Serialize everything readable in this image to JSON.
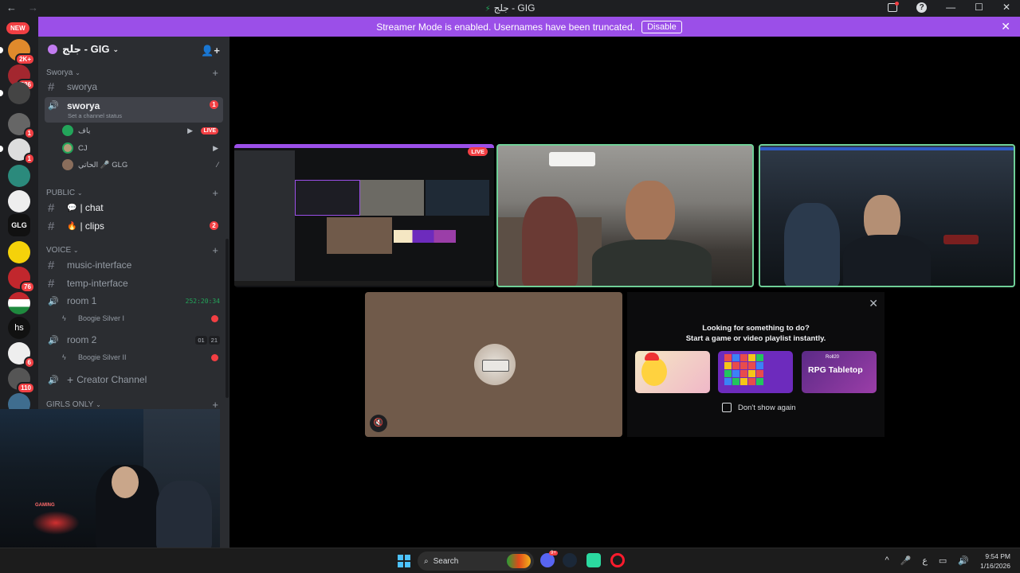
{
  "titlebar": {
    "back_icon": "←",
    "forward_icon": "→",
    "title_prefix": "⚡",
    "title": "جلج - GIG",
    "help_icon": "?",
    "minimize_icon": "—",
    "maximize_icon": "☐",
    "close_icon": "✕"
  },
  "guilds": {
    "new_label": "NEW",
    "badges": [
      "2K+",
      "536",
      "1",
      "1",
      "76",
      "6",
      "110"
    ],
    "hs_label": "hs",
    "glg_label": "GLG"
  },
  "banner": {
    "text": "Streamer Mode is enabled. Usernames have been truncated.",
    "disable_label": "Disable",
    "close_icon": "✕"
  },
  "server": {
    "name": "جلج - GIG",
    "caret": "⌄",
    "invite_icon": "👤+"
  },
  "categories": {
    "sworya": "Sworya",
    "public": "PUBLIC",
    "voice": "VOICE",
    "girls_only": "GIRLS ONLY"
  },
  "channels": {
    "sworya_text": "sworya",
    "sworya_voice": "sworya",
    "sworya_voice_badge": "1",
    "sworya_status": "Set a channel status",
    "chat": "| chat",
    "chat_emoji": "💬",
    "clips": "| clips",
    "clips_emoji": "🔥",
    "clips_badge": "2",
    "music_interface": "music-interface",
    "temp_interface": "temp-interface",
    "room1": "room 1",
    "room1_timer": "252:20:34",
    "room2": "room 2",
    "room2_pill_a": "01",
    "room2_pill_b": "21",
    "creator_channel": "Creator Channel",
    "creator_plus": "+"
  },
  "voice_users": {
    "user1": "ياف",
    "user1_live": "LIVE",
    "user2": "CJ",
    "user3": "الحاتي 🎤 GLG"
  },
  "bots": {
    "boogie1": "Boogie Silver I",
    "boogie2": "Boogie Silver II"
  },
  "stage": {
    "live_label": "LIVE",
    "mute_icon": "🔇"
  },
  "suggestions": {
    "line1": "Looking for something to do?",
    "line2": "Start a game or video playlist instantly.",
    "card3_title": "RPG Tabletop",
    "card3_sub": "Roll20",
    "dont_show": "Don't show again",
    "close_icon": "✕"
  },
  "taskbar": {
    "search_label": "Search",
    "search_icon": "⌕",
    "discord_badge": "9+",
    "tray_chevron": "^",
    "tray_lang": "ع",
    "time": "9:54 PM",
    "date": "1/16/2026"
  },
  "colors": {
    "accent": "#9b4fe8",
    "danger": "#f23f43",
    "online": "#23a55a",
    "speaking": "#6fcf97",
    "sidebar": "#2b2d31",
    "rail": "#1e1f22"
  }
}
